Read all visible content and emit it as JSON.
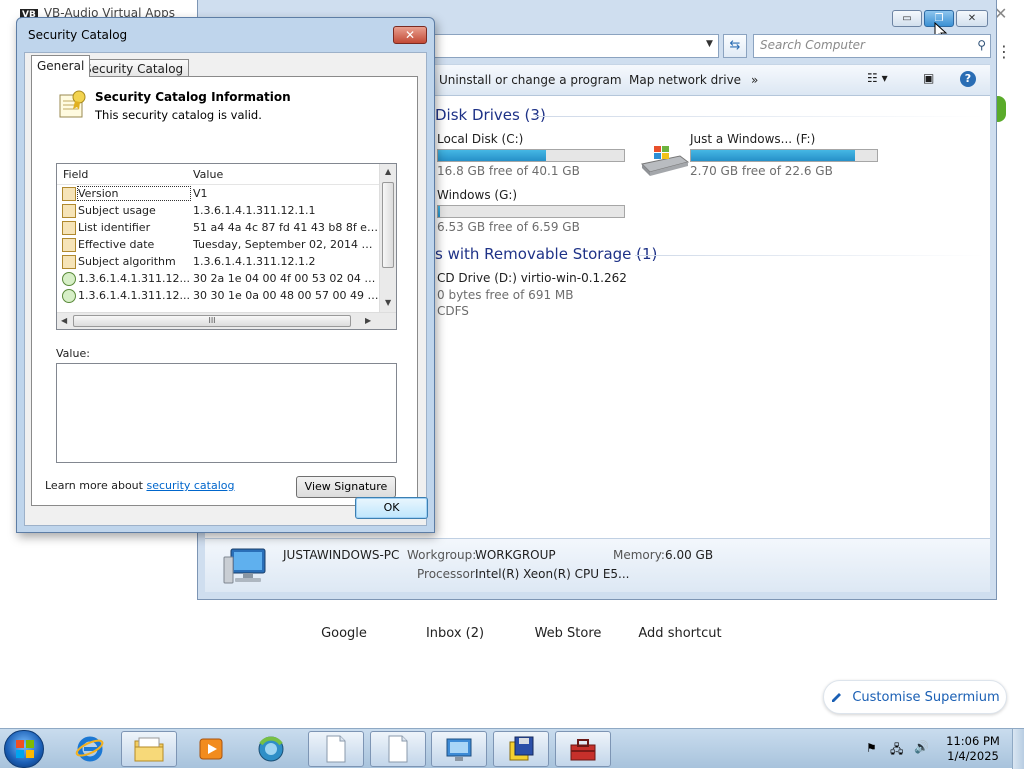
{
  "background_browser": {
    "title": "VB-Audio Virtual Apps",
    "title_badge": "VB",
    "close_glyph": "✕",
    "menu_glyph": "⋮",
    "shortcuts": [
      "Google",
      "Inbox (2)",
      "Web Store",
      "Add shortcut"
    ],
    "customise_label": "Customise Supermium",
    "customise_icon": "pencil-icon"
  },
  "explorer": {
    "search_placeholder": "Search Computer",
    "commands": [
      "Uninstall or change a program",
      "Map network drive",
      "»"
    ],
    "groups": {
      "hard_disks": "Disk Drives (3)",
      "removable": "s with Removable Storage (1)"
    },
    "drives": [
      {
        "name": "Local Disk (C:)",
        "free": "16.8 GB free of 40.1 GB",
        "used_fraction": 0.58
      },
      {
        "name": "Just a Windows... (F:)",
        "free": "2.70 GB free of 22.6 GB",
        "used_fraction": 0.88
      },
      {
        "name": "Windows (G:)",
        "free": "6.53 GB free of 6.59 GB",
        "used_fraction": 0.01
      }
    ],
    "cd_drive": {
      "name": "CD Drive (D:) virtio-win-0.1.262",
      "free": "0 bytes free of 691 MB",
      "fs": "CDFS"
    },
    "details": {
      "pc_name": "JUSTAWINDOWS-PC",
      "workgroup_label": "Workgroup:",
      "workgroup": "WORKGROUP",
      "memory_label": "Memory:",
      "memory": "6.00 GB",
      "processor_label": "Processor:",
      "processor": "Intel(R) Xeon(R) CPU E5..."
    }
  },
  "dialog": {
    "title": "Security Catalog",
    "close_glyph": "✕",
    "tabs": [
      "General",
      "Security Catalog"
    ],
    "info_title": "Security Catalog Information",
    "info_sub": "This security catalog is valid.",
    "columns": [
      "Field",
      "Value"
    ],
    "rows": [
      {
        "field": "Version",
        "value": "V1",
        "icon": "doc"
      },
      {
        "field": "Subject usage",
        "value": "1.3.6.1.4.1.311.12.1.1",
        "icon": "doc"
      },
      {
        "field": "List identifier",
        "value": "51 a4 4a 4c 87 fd 41 43 b8 8f e2 b9 ...",
        "icon": "doc"
      },
      {
        "field": "Effective date",
        "value": "Tuesday, September 02, 2014 7:17:...",
        "icon": "doc"
      },
      {
        "field": "Subject algorithm",
        "value": "1.3.6.1.4.1.311.12.1.2",
        "icon": "doc"
      },
      {
        "field": "1.3.6.1.4.1.311.12...",
        "value": "30 2a 1e 04 00 4f 00 53 02 04 10 01...",
        "icon": "green"
      },
      {
        "field": "1.3.6.1.4.1.311.12...",
        "value": "30 30 1e 0a 00 48 00 57 00 49 00 4...",
        "icon": "green"
      }
    ],
    "hscroll_grip": "III",
    "value_label": "Value:",
    "learn_prefix": "Learn more about ",
    "learn_link": "security catalog",
    "view_signature": "View Signature",
    "ok": "OK"
  },
  "taskbar": {
    "time": "11:06 PM",
    "date": "1/4/2025",
    "tray_icons": [
      "flag-icon",
      "network-icon",
      "volume-icon"
    ]
  }
}
